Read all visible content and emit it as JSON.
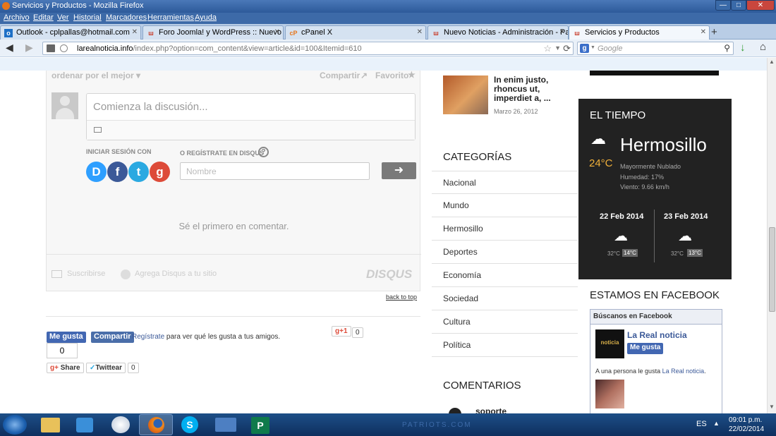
{
  "window": {
    "title": "Servicios y Productos - Mozilla Firefox"
  },
  "menu": [
    "Archivo",
    "Editar",
    "Ver",
    "Historial",
    "Marcadores",
    "Herramientas",
    "Ayuda"
  ],
  "tabs": [
    {
      "label": "Outlook - cplpallas@hotmail.com",
      "icon": "outlook-icon"
    },
    {
      "label": "Foro Joomla! y WordPress :: Nuevo T...",
      "icon": "joomla-forum-icon"
    },
    {
      "label": "cPanel X",
      "icon": "cpanel-icon"
    },
    {
      "label": "Nuevo Noticias - Administración - Pa...",
      "icon": "joomla-admin-icon"
    },
    {
      "label": "Servicios y Productos",
      "icon": "joomla-icon"
    }
  ],
  "nav": {
    "url_domain": "larealnoticia.info",
    "url_path": "/index.php?option=com_content&view=article&id=100&Itemid=610",
    "search_placeholder": "Google",
    "search_engine_letter": "g"
  },
  "disqus": {
    "sort_label": "ordenar por el mejor ▾",
    "share_label": "Compartir",
    "favorite_label": "Favorito",
    "composer_placeholder": "Comienza la discusión...",
    "login_label": "INICIAR SESIÓN CON",
    "register_label": "O REGÍSTRATE EN DISQUS",
    "help": "?",
    "name_placeholder": "Nombre",
    "submit_arrow": "➜",
    "empty_message": "Sé el primero en comentar.",
    "subscribe_label": "Suscribirse",
    "add_disqus_label": "Agrega Disqus a tu sitio",
    "brand": "DISQUS",
    "social_letters": [
      "D",
      "f",
      "t",
      "g"
    ]
  },
  "back_to_top": "back to top",
  "share_bar": {
    "like": "Me gusta",
    "share": "Compartir",
    "register_link": "Regístrate",
    "register_text": " para ver qué les gusta a tus amigos.",
    "like_count": "0",
    "gplus": "g+1",
    "gplus_count": "0",
    "gshare": "Share",
    "tweet": "Twittear",
    "tweet_count": "0"
  },
  "article_thumb": {
    "title": "In enim justo, rhoncus ut, imperdiet a, ...",
    "date": "Marzo 26, 2012"
  },
  "categories": {
    "heading": "CATEGORÍAS",
    "items": [
      "Nacional",
      "Mundo",
      "Hermosillo",
      "Deportes",
      "Economía",
      "Sociedad",
      "Cultura",
      "Política"
    ]
  },
  "comments": {
    "heading": "COMENTARIOS",
    "first_author": "soporte"
  },
  "weather": {
    "heading": "EL TIEMPO",
    "city": "Hermosillo",
    "temp": "24°C",
    "condition": "Mayormente Nublado",
    "humidity": "Humedad: 17%",
    "wind": "Viento: 9.66 km/h",
    "forecast": [
      {
        "date": "22 Feb 2014",
        "low": "32°C",
        "high": "14°C"
      },
      {
        "date": "23 Feb 2014",
        "low": "32°C",
        "high": "13°C"
      }
    ]
  },
  "facebook": {
    "heading": "ESTAMOS EN FACEBOOK",
    "box_title": "Búscanos en Facebook",
    "page_name": "La Real noticia",
    "like": "Me gusta",
    "likes_text": "A una persona le gusta ",
    "likes_link": "La Real noticia",
    "likes_end": "."
  },
  "taskbar": {
    "lang": "ES",
    "time": "09:01 p.m.",
    "date": "22/02/2014",
    "watermark": "PATRIOTS.COM"
  }
}
